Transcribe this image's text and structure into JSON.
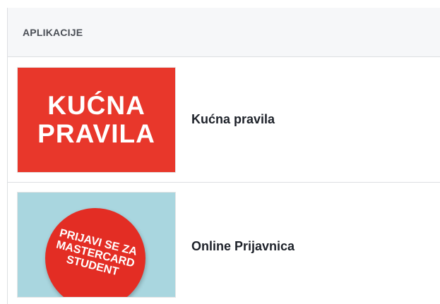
{
  "section": {
    "title": "APLIKACIJE"
  },
  "apps": [
    {
      "name": "Kućna pravila",
      "thumbnail_lines": [
        "KUĆNA",
        "PRAVILA"
      ],
      "thumbnail_color": "#e8372b"
    },
    {
      "name": "Online Prijavnica",
      "thumbnail_lines": [
        "PRIJAVI SE ZA",
        "MASTERCARD",
        "STUDENT"
      ],
      "thumbnail_color": "#a9d6df",
      "badge_color": "#e32d24"
    }
  ]
}
